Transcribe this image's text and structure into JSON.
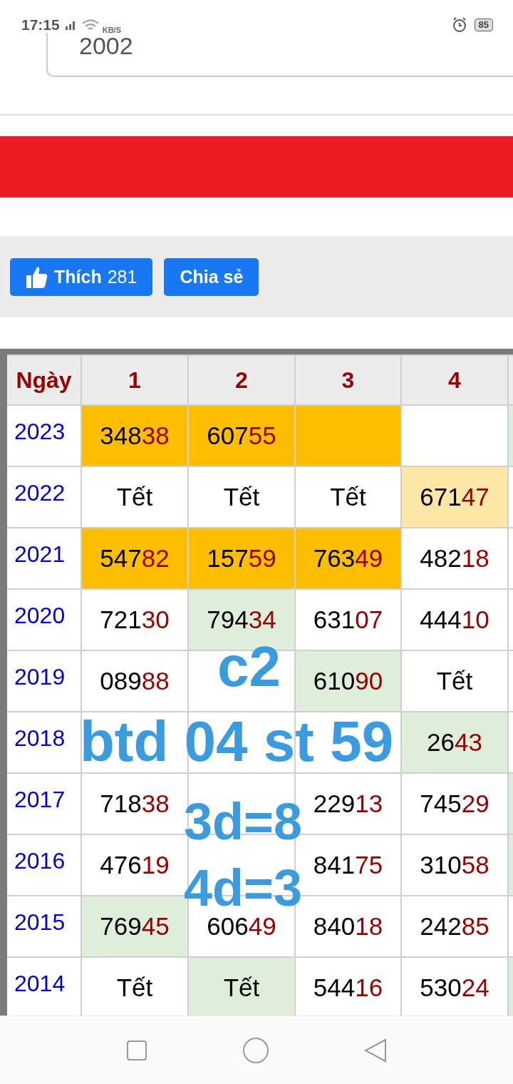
{
  "status_bar": {
    "time": "17:15",
    "speed_unit": "KB/S",
    "battery": "85"
  },
  "year_field": {
    "value": "2002"
  },
  "actions": {
    "like_label": "Thích",
    "like_count": "281",
    "share_label": "Chia sẻ"
  },
  "table": {
    "year_header": "Ngày",
    "columns": [
      "1",
      "2",
      "3",
      "4"
    ],
    "rows": [
      {
        "year": "2023",
        "cells": [
          {
            "kind": "number",
            "value": "34838",
            "color": "#fdbe00"
          },
          {
            "kind": "number",
            "value": "60755",
            "color": "#fdbe00"
          },
          {
            "kind": "empty",
            "color": "#fdbe00"
          },
          {
            "kind": "empty",
            "color": "#ffffff"
          },
          {
            "kind": "empty",
            "color": "#dfeedb"
          }
        ]
      },
      {
        "year": "2022",
        "cells": [
          {
            "kind": "text",
            "value": "Tết",
            "color": "#ffffff"
          },
          {
            "kind": "text",
            "value": "Tết",
            "color": "#ffffff"
          },
          {
            "kind": "text",
            "value": "Tết",
            "color": "#ffffff"
          },
          {
            "kind": "number",
            "value": "67147",
            "color": "#fde7a6"
          },
          {
            "kind": "empty",
            "color": "#ffffff"
          }
        ]
      },
      {
        "year": "2021",
        "cells": [
          {
            "kind": "number",
            "value": "54782",
            "color": "#fdbe00"
          },
          {
            "kind": "number",
            "value": "15759",
            "color": "#fdbe00"
          },
          {
            "kind": "number",
            "value": "76349",
            "color": "#fdbe00"
          },
          {
            "kind": "number",
            "value": "48218",
            "color": "#ffffff"
          },
          {
            "kind": "empty",
            "color": "#ffffff"
          }
        ]
      },
      {
        "year": "2020",
        "cells": [
          {
            "kind": "number",
            "value": "72130",
            "color": "#ffffff"
          },
          {
            "kind": "number",
            "value": "79434",
            "color": "#dfeedb"
          },
          {
            "kind": "number",
            "value": "63107",
            "color": "#ffffff"
          },
          {
            "kind": "number",
            "value": "44410",
            "color": "#ffffff"
          },
          {
            "kind": "empty",
            "color": "#ffffff"
          }
        ]
      },
      {
        "year": "2019",
        "cells": [
          {
            "kind": "number",
            "value": "08988",
            "color": "#ffffff"
          },
          {
            "kind": "covered",
            "color": "#ffffff"
          },
          {
            "kind": "number",
            "value": "61090",
            "color": "#dfeedb"
          },
          {
            "kind": "text",
            "value": "Tết",
            "color": "#ffffff"
          },
          {
            "kind": "empty",
            "color": "#ffffff"
          }
        ]
      },
      {
        "year": "2018",
        "cells": [
          {
            "kind": "covered",
            "color": "#ffffff"
          },
          {
            "kind": "covered",
            "color": "#ffffff"
          },
          {
            "kind": "covered",
            "color": "#ffffff"
          },
          {
            "kind": "number",
            "value": "2643",
            "color": "#dfeedb"
          },
          {
            "kind": "empty",
            "color": "#ffffff"
          }
        ]
      },
      {
        "year": "2017",
        "cells": [
          {
            "kind": "number",
            "value": "71838",
            "color": "#ffffff"
          },
          {
            "kind": "covered",
            "color": "#ffffff"
          },
          {
            "kind": "number",
            "value": "22913",
            "color": "#ffffff"
          },
          {
            "kind": "number",
            "value": "74529",
            "color": "#ffffff"
          },
          {
            "kind": "empty",
            "color": "#dfeedb"
          }
        ]
      },
      {
        "year": "2016",
        "cells": [
          {
            "kind": "number",
            "value": "47619",
            "color": "#ffffff"
          },
          {
            "kind": "covered",
            "color": "#ffffff"
          },
          {
            "kind": "number",
            "value": "84175",
            "color": "#ffffff"
          },
          {
            "kind": "number",
            "value": "31058",
            "color": "#ffffff"
          },
          {
            "kind": "empty",
            "color": "#dfeedb"
          }
        ]
      },
      {
        "year": "2015",
        "cells": [
          {
            "kind": "number",
            "value": "76945",
            "color": "#dfeedb"
          },
          {
            "kind": "number",
            "value": "60649",
            "color": "#ffffff"
          },
          {
            "kind": "number",
            "value": "84018",
            "color": "#ffffff"
          },
          {
            "kind": "number",
            "value": "24285",
            "color": "#ffffff"
          },
          {
            "kind": "empty",
            "color": "#ffffff"
          }
        ]
      },
      {
        "year": "2014",
        "cells": [
          {
            "kind": "text",
            "value": "Tết",
            "color": "#ffffff"
          },
          {
            "kind": "text",
            "value": "Tết",
            "color": "#dfeedb"
          },
          {
            "kind": "number",
            "value": "54416",
            "color": "#ffffff"
          },
          {
            "kind": "number",
            "value": "53024",
            "color": "#ffffff"
          },
          {
            "kind": "empty",
            "color": "#dfeedb"
          }
        ]
      }
    ]
  },
  "annotation": [
    "c2",
    "btd 04 st 59",
    "3d=8",
    "4d=3"
  ]
}
